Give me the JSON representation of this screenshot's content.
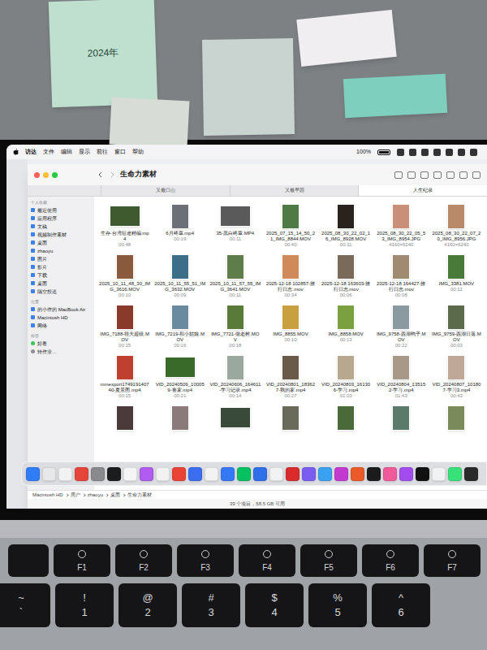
{
  "wall": {
    "notes": [
      {
        "text": "2024年",
        "color": "#bfe0cf"
      },
      {
        "text": "",
        "color": "#d7dcd6"
      },
      {
        "text": "",
        "color": "#c9d3cf"
      },
      {
        "text": "",
        "color": "#f0eef0"
      },
      {
        "text": "",
        "color": "#7fcfbf"
      }
    ]
  },
  "menu_bar": {
    "app": "访达",
    "items": [
      "文件",
      "编辑",
      "显示",
      "前往",
      "窗口",
      "帮助"
    ],
    "battery": "100%"
  },
  "window": {
    "title": "生命力素材"
  },
  "tabs": [
    {
      "label": "又最口山",
      "selected": false
    },
    {
      "label": "又最早园",
      "selected": false
    },
    {
      "label": "人生纪录",
      "selected": true
    }
  ],
  "sidebar": {
    "sections": [
      {
        "header": "个人收藏",
        "items": [
          {
            "label": "最近使用",
            "color": ""
          },
          {
            "label": "应用程序",
            "color": ""
          },
          {
            "label": "文稿",
            "color": ""
          },
          {
            "label": "视频制作素材",
            "color": ""
          },
          {
            "label": "桌面",
            "color": ""
          },
          {
            "label": "zhaoyu",
            "color": ""
          },
          {
            "label": "图片",
            "color": ""
          },
          {
            "label": "影片",
            "color": ""
          },
          {
            "label": "下载",
            "color": ""
          },
          {
            "label": "桌面",
            "color": ""
          },
          {
            "label": "隔空投送",
            "color": ""
          }
        ]
      },
      {
        "header": "位置",
        "items": [
          {
            "label": "的小作的 MacBook Air",
            "color": ""
          },
          {
            "label": "Macintosh HD",
            "color": ""
          },
          {
            "label": "网络",
            "color": ""
          }
        ]
      },
      {
        "header": "标签",
        "items": [
          {
            "label": "好看",
            "color": "#34c759"
          },
          {
            "label": "转作业…",
            "color": "#8e8e93"
          }
        ]
      }
    ]
  },
  "files": [
    {
      "name": "生存-台湾征途精编.mp4",
      "info": "00:48",
      "kind": "landscape",
      "color": "#3f5a2e"
    },
    {
      "name": "6月终章.mp4",
      "info": "00:19",
      "kind": "portrait",
      "color": "#6b6f78"
    },
    {
      "name": "35-黑白终章.MP4",
      "info": "00:11",
      "kind": "landscape",
      "color": "#5a5a5a"
    },
    {
      "name": "2025_07_15_14_50_21_IMG_8844.MOV",
      "info": "00:40",
      "kind": "portrait",
      "color": "#4f7a45"
    },
    {
      "name": "2025_08_30_22_02_16_IMG_8928.MOV",
      "info": "00:11",
      "kind": "portrait",
      "color": "#2a221c"
    },
    {
      "name": "2025_08_30_22_05_53_IMG_8954.JPG",
      "info": "4160×6240",
      "kind": "portrait",
      "color": "#c98f78"
    },
    {
      "name": "2025_08_30_22_07_20_IMG_8956.JPG",
      "info": "4160×6240",
      "kind": "portrait",
      "color": "#b88a6a"
    },
    {
      "name": "2025_10_11_48_30_IMG_3616.MOV",
      "info": "00:10",
      "kind": "portrait",
      "color": "#8a5a3c"
    },
    {
      "name": "2025_10_11_55_51_IMG_3632.MOV",
      "info": "00:09",
      "kind": "portrait",
      "color": "#3c6e8a"
    },
    {
      "name": "2025_10_11_57_55_IMG_3641.MOV",
      "info": "00:11",
      "kind": "portrait",
      "color": "#5e7d4a"
    },
    {
      "name": "2025-12-18 102857-旅行日志.mov",
      "info": "00:34",
      "kind": "portrait",
      "color": "#d08a5a"
    },
    {
      "name": "2025-12-18 163603-旅行日志.mov",
      "info": "00:06",
      "kind": "portrait",
      "color": "#7a6a5a"
    },
    {
      "name": "2025-12-18 164427-旅行日志.mov",
      "info": "00:08",
      "kind": "portrait",
      "color": "#a08a70"
    },
    {
      "name": "IMG_3381.MOV",
      "info": "00:12",
      "kind": "portrait",
      "color": "#4a7a3a"
    },
    {
      "name": "IMG_7188-很大超级.MOV",
      "info": "00:15",
      "kind": "portrait",
      "color": "#8a3a2a"
    },
    {
      "name": "IMG_7219-和小姑娘.MOV",
      "info": "00:16",
      "kind": "portrait",
      "color": "#6a8aa0"
    },
    {
      "name": "IMG_7721-做老树.MOV",
      "info": "00:18",
      "kind": "portrait",
      "color": "#5a7a3a"
    },
    {
      "name": "IMG_8855.MOV",
      "info": "00:10",
      "kind": "portrait",
      "color": "#c8a040"
    },
    {
      "name": "IMG_8858.MOV",
      "info": "00:13",
      "kind": "portrait",
      "color": "#7aa040"
    },
    {
      "name": "IMG_9758-西湖鸭子.MOV",
      "info": "00:22",
      "kind": "portrait",
      "color": "#8a9aa0"
    },
    {
      "name": "IMG_9759-西湖日落.MOV",
      "info": "00:03",
      "kind": "portrait",
      "color": "#5a6a4a"
    },
    {
      "name": "mmexport1749191407 40-夏景图.mp4",
      "info": "00:15",
      "kind": "portrait",
      "color": "#c04030"
    },
    {
      "name": "VID_20240509_100059-鲁家.mp4",
      "info": "00:21",
      "kind": "landscape",
      "color": "#3a6a2a"
    },
    {
      "name": "VID_20240606_164611-学习记录.mp4",
      "info": "00:14",
      "kind": "portrait",
      "color": "#9aa8a0"
    },
    {
      "name": "VID_20240801_183627-我的家.mp4",
      "info": "00:27",
      "kind": "portrait",
      "color": "#6a5a4a"
    },
    {
      "name": "VID_20240803_161306-学习.mp4",
      "info": "01:03",
      "kind": "portrait",
      "color": "#b8a890"
    },
    {
      "name": "VID_20240804_135152-学习.mp4",
      "info": "01:43",
      "kind": "portrait",
      "color": "#a89888"
    },
    {
      "name": "VID_20240807_101807-学习3.mp4",
      "info": "00:43",
      "kind": "portrait",
      "color": "#c0a898"
    }
  ],
  "partial_row": [
    {
      "kind": "portrait",
      "color": "#4a3a3a"
    },
    {
      "kind": "portrait",
      "color": "#8a7a7a"
    },
    {
      "kind": "landscape",
      "color": "#3a4a3a"
    },
    {
      "kind": "portrait",
      "color": "#6a6a5a"
    },
    {
      "kind": "portrait",
      "color": "#4a6a3a"
    },
    {
      "kind": "portrait",
      "color": "#5a7a6a"
    },
    {
      "kind": "portrait",
      "color": "#7a8a5a"
    }
  ],
  "path_bar": [
    "Macintosh HD",
    "用户",
    "zhaoyu",
    "桌面",
    "生命力素材"
  ],
  "status_bar": "39 个项目，58.5 GB 可用",
  "dock": [
    {
      "color": "#2f7cf6"
    },
    {
      "color": "#e8e8ea"
    },
    {
      "color": "#f2f2f2"
    },
    {
      "color": "#e6453a"
    },
    {
      "color": "#8a8a8e"
    },
    {
      "color": "#1c1c1e"
    },
    {
      "color": "#f5f5f5"
    },
    {
      "color": "#b05cf0"
    },
    {
      "color": "#f2f2f2"
    },
    {
      "color": "#ea4335"
    },
    {
      "color": "#3b6df0"
    },
    {
      "color": "#f2f2f2"
    },
    {
      "color": "#3478f6"
    },
    {
      "color": "#07c160"
    },
    {
      "color": "#2f6fea"
    },
    {
      "color": "#f2f2f2"
    },
    {
      "color": "#d92b2b"
    },
    {
      "color": "#7b5cf0"
    },
    {
      "color": "#3aa0f0"
    },
    {
      "color": "#c23ad0"
    },
    {
      "color": "#ea5a2a"
    },
    {
      "color": "#1c1c1e"
    },
    {
      "color": "#f05a9a"
    },
    {
      "color": "#a24cf0"
    },
    {
      "color": "#111111"
    },
    {
      "color": "#f2f2f2"
    },
    {
      "color": "#38e07a"
    },
    {
      "color": "#2a2a2a"
    }
  ],
  "keyboard": {
    "fn_row": [
      "F1",
      "F2",
      "F3",
      "F4",
      "F5",
      "F6",
      "F7"
    ],
    "number_row": [
      {
        "top": "~",
        "bottom": "`"
      },
      {
        "top": "!",
        "bottom": "1"
      },
      {
        "top": "@",
        "bottom": "2"
      },
      {
        "top": "#",
        "bottom": "3"
      },
      {
        "top": "$",
        "bottom": "4"
      },
      {
        "top": "%",
        "bottom": "5"
      },
      {
        "top": "^",
        "bottom": "6"
      }
    ]
  }
}
